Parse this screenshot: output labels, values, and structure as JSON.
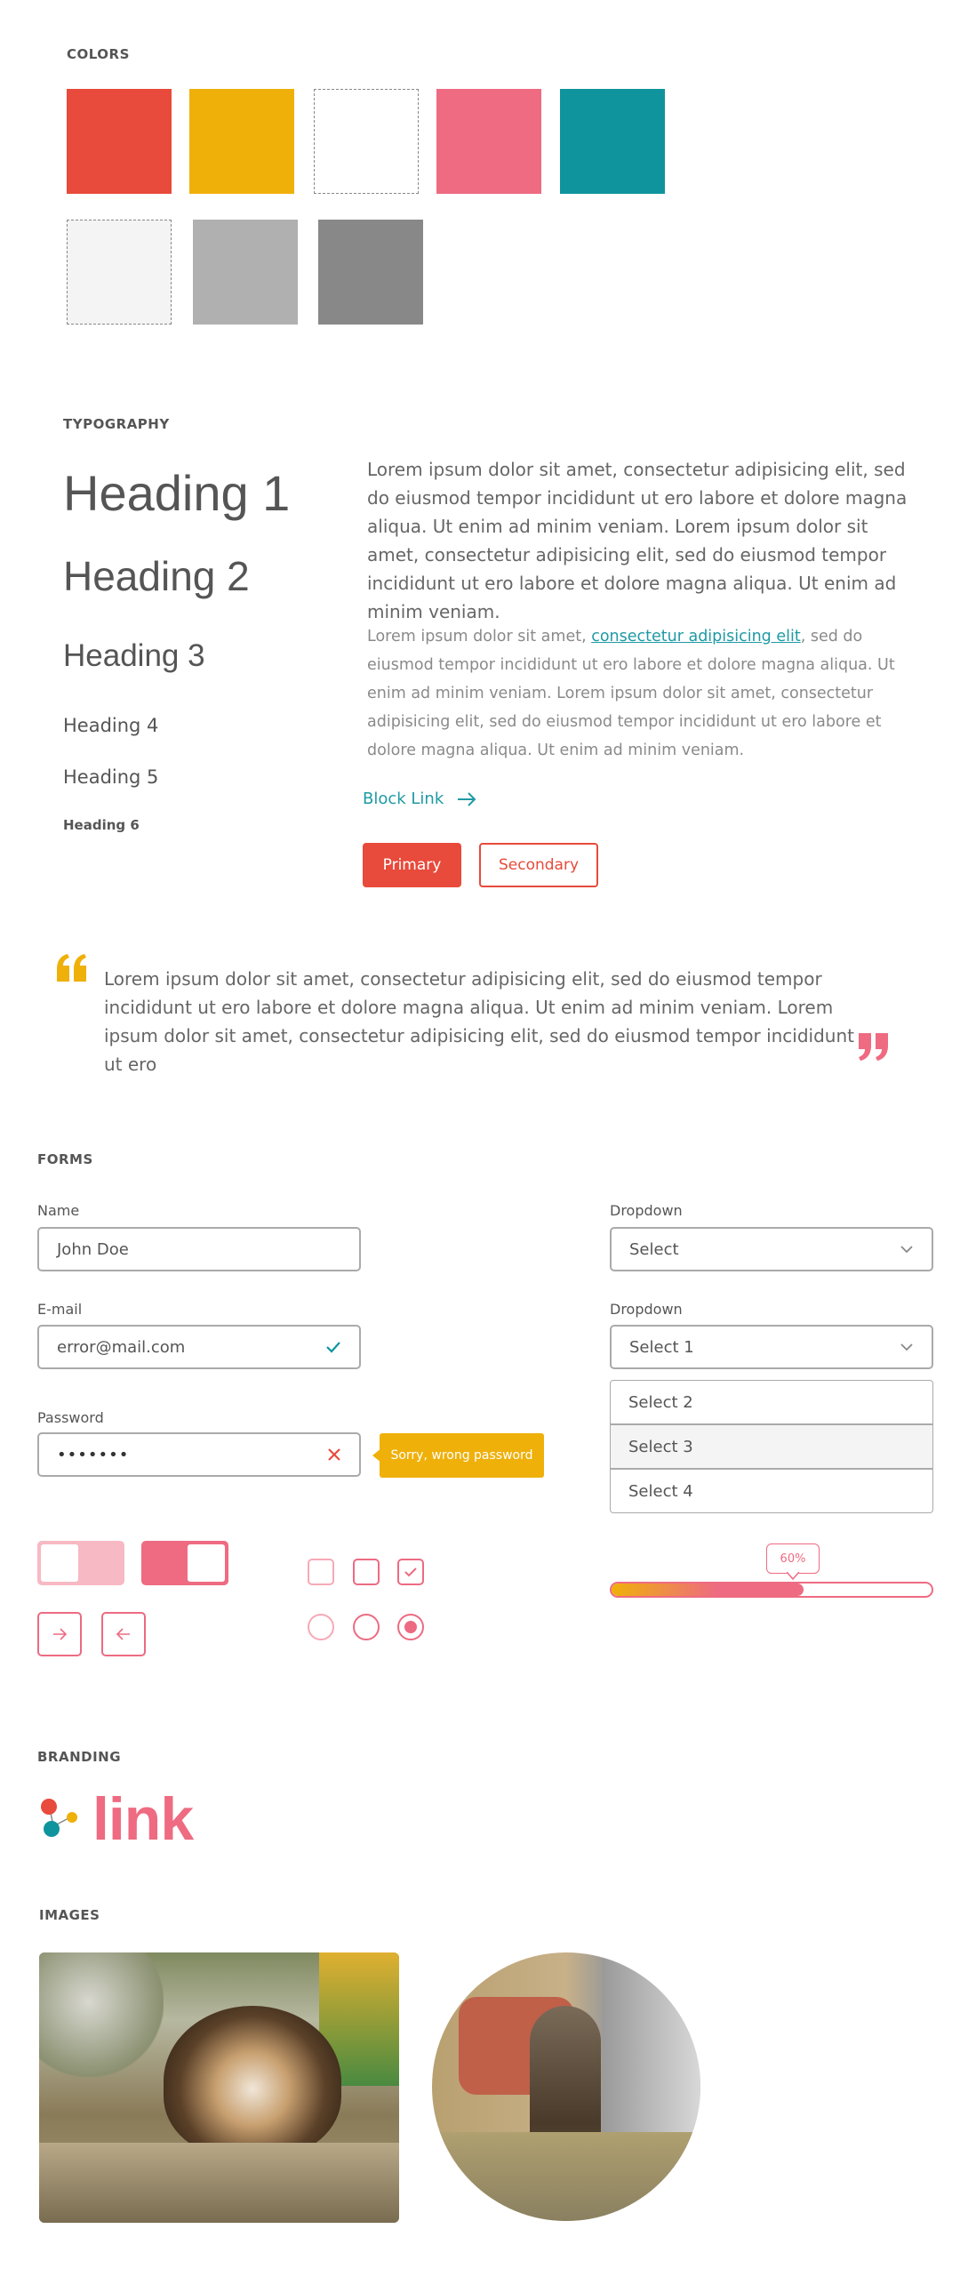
{
  "colors": {
    "title": "COLORS",
    "swatches_row1": [
      "#e84a3b",
      "#efb00a",
      "#ffffff",
      "#ee6b82",
      "#0f949e"
    ],
    "swatches_row2": [
      "#f4f4f4",
      "#b0b0b0",
      "#888888"
    ]
  },
  "typography": {
    "title": "TYPOGRAPHY",
    "h1": "Heading 1",
    "h2": "Heading 2",
    "h3": "Heading 3",
    "h4": "Heading 4",
    "h5": "Heading 5",
    "h6": "Heading 6",
    "paragraph_large": "Lorem ipsum dolor sit amet, consectetur adipisicing elit, sed do eiusmod tempor incididunt ut ero labore et dolore magna aliqua. Ut enim ad minim veniam. Lorem ipsum dolor sit amet, consectetur adipisicing elit, sed do eiusmod tempor incididunt ut ero labore et dolore magna aliqua. Ut enim ad minim veniam.",
    "paragraph_small_before": "Lorem ipsum dolor sit amet, ",
    "paragraph_small_link": "consectetur adipisicing elit",
    "paragraph_small_after": ", sed do eiusmod tempor incididunt ut ero labore et dolore magna aliqua. Ut enim ad minim veniam. Lorem ipsum dolor sit amet, consectetur adipisicing elit, sed do eiusmod tempor incididunt ut ero labore et dolore magna aliqua. Ut enim ad minim veniam.",
    "block_link": "Block Link",
    "primary_button": "Primary",
    "secondary_button": "Secondary"
  },
  "quote": {
    "text": "Lorem ipsum dolor sit amet, consectetur adipisicing elit, sed do eiusmod tempor incididunt ut ero labore et dolore magna aliqua. Ut enim ad minim veniam. Lorem ipsum dolor sit amet, consectetur adipisicing elit, sed do eiusmod tempor incididunt ut ero"
  },
  "forms": {
    "title": "FORMS",
    "name_label": "Name",
    "name_value": "John Doe",
    "email_label": "E-mail",
    "email_value": "error@mail.com",
    "password_label": "Password",
    "password_value": "•••••••",
    "password_error": "Sorry, wrong password",
    "dropdown1_label": "Dropdown",
    "dropdown1_value": "Select",
    "dropdown2_label": "Dropdown",
    "dropdown2_value": "Select 1",
    "dropdown2_options": [
      "Select 2",
      "Select 3",
      "Select 4"
    ],
    "progress_label": "60%",
    "progress_value": 0.6
  },
  "branding": {
    "title": "BRANDING",
    "logo_text": "link"
  },
  "images": {
    "title": "IMAGES"
  }
}
